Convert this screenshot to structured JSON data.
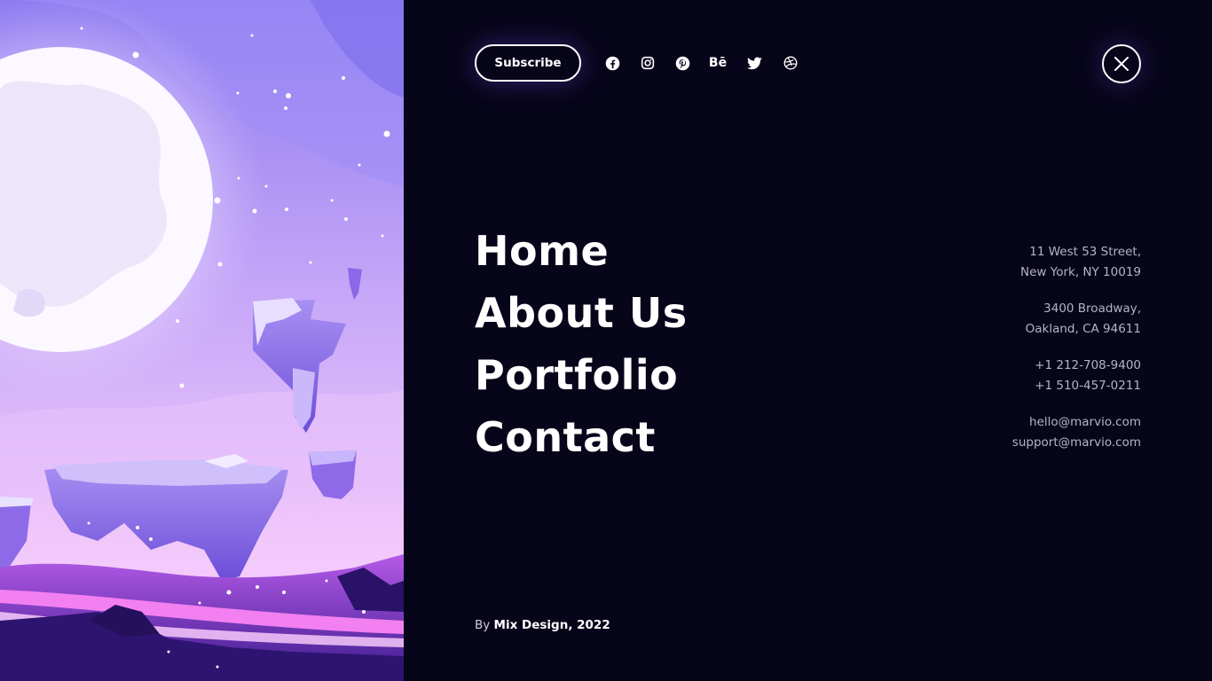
{
  "header": {
    "subscribe_label": "Subscribe",
    "social_icons": [
      "facebook-icon",
      "instagram-icon",
      "pinterest-icon",
      "behance-icon",
      "twitter-icon",
      "dribbble-icon"
    ],
    "behance_text": "Bē",
    "close_icon": "close-icon"
  },
  "nav": {
    "items": [
      {
        "label": "Home"
      },
      {
        "label": "About Us"
      },
      {
        "label": "Portfolio"
      },
      {
        "label": "Contact"
      }
    ]
  },
  "contact": {
    "address1": {
      "line1": "11 West 53 Street,",
      "line2": "New York, NY 10019"
    },
    "address2": {
      "line1": "3400 Broadway,",
      "line2": "Oakland, CA 94611"
    },
    "phones": {
      "line1": "+1 212-708-9400",
      "line2": "+1 510-457-0211"
    },
    "emails": {
      "line1": "hello@marvio.com",
      "line2": "support@marvio.com"
    }
  },
  "footer": {
    "credit_prefix": "By ",
    "credit_name": "Mix Design, 2022"
  },
  "colors": {
    "background": "#07051a",
    "text": "#ffffff",
    "muted": "#b5b3c8",
    "accent": "#7b5cff"
  }
}
